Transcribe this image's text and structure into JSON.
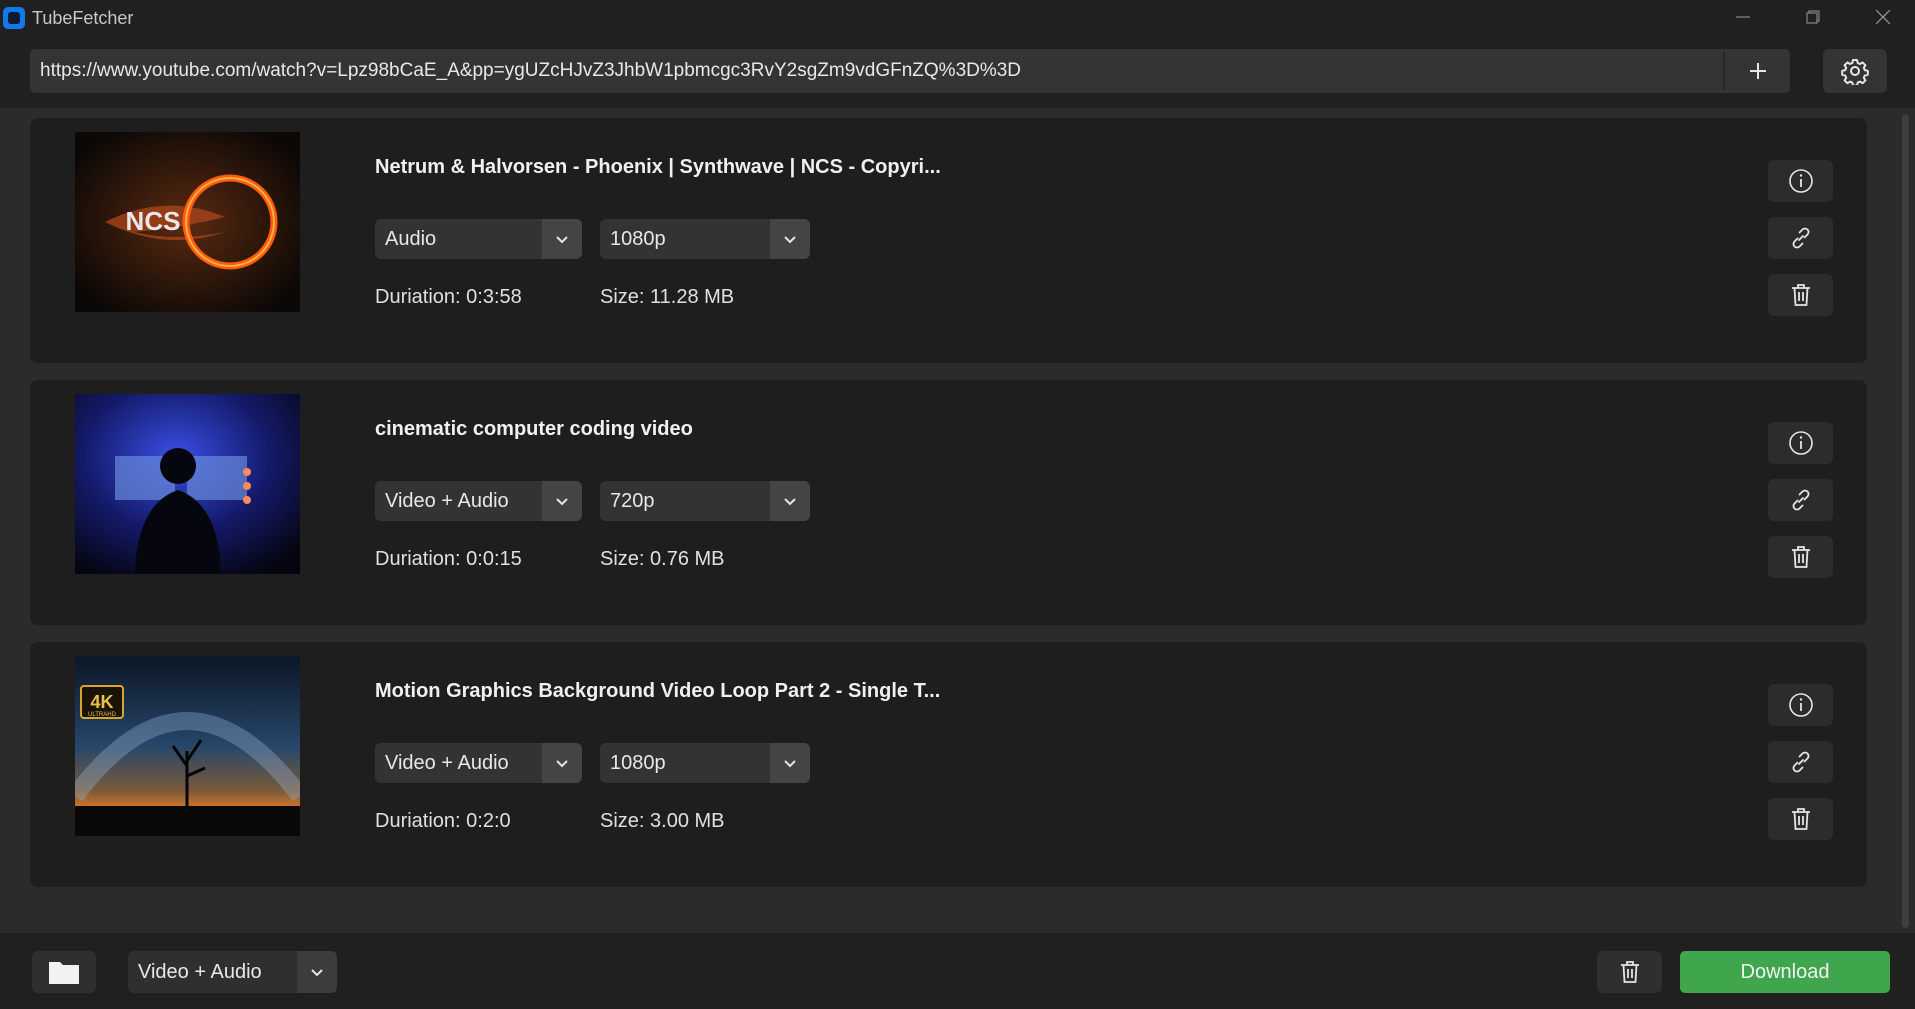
{
  "app": {
    "title": "TubeFetcher"
  },
  "window_controls": [
    "minimize",
    "restore",
    "close"
  ],
  "url_bar": {
    "value": "https://www.youtube.com/watch?v=Lpz98bCaE_A&pp=ygUZcHJvZ3JhbW1pbmcgc3RvY2sgZm9vdGFnZQ%3D%3D",
    "add_icon": "plus-icon",
    "settings_icon": "gear-icon"
  },
  "videos": [
    {
      "title": "Netrum & Halvorsen - Phoenix | Synthwave | NCS - Copyri...",
      "type": "Audio",
      "resolution": "1080p",
      "duration": "Duriation: 0:3:58",
      "size": "Size: 11.28 MB",
      "thumbnail_text": "NCS"
    },
    {
      "title": "cinematic computer coding video",
      "type": "Video + Audio",
      "resolution": "720p",
      "duration": "Duriation: 0:0:15",
      "size": "Size: 0.76 MB"
    },
    {
      "title": "Motion Graphics Background Video Loop Part 2 - Single T...",
      "type": "Video + Audio",
      "resolution": "1080p",
      "duration": "Duriation: 0:2:0",
      "size": "Size: 3.00 MB",
      "thumbnail_text": "4K",
      "thumbnail_subtext": "ULTRAHD"
    }
  ],
  "card_actions": [
    "info-icon",
    "link-icon",
    "trash-icon"
  ],
  "bottom_bar": {
    "folder_icon": "folder-icon",
    "default_type": "Video + Audio",
    "clear_icon": "trash-icon",
    "download_label": "Download"
  },
  "colors": {
    "background": "#202020",
    "list_background": "#2b2b2b",
    "card": "#1e1e1e",
    "accent": "#3fa64d",
    "app_icon": "#1479e8"
  }
}
